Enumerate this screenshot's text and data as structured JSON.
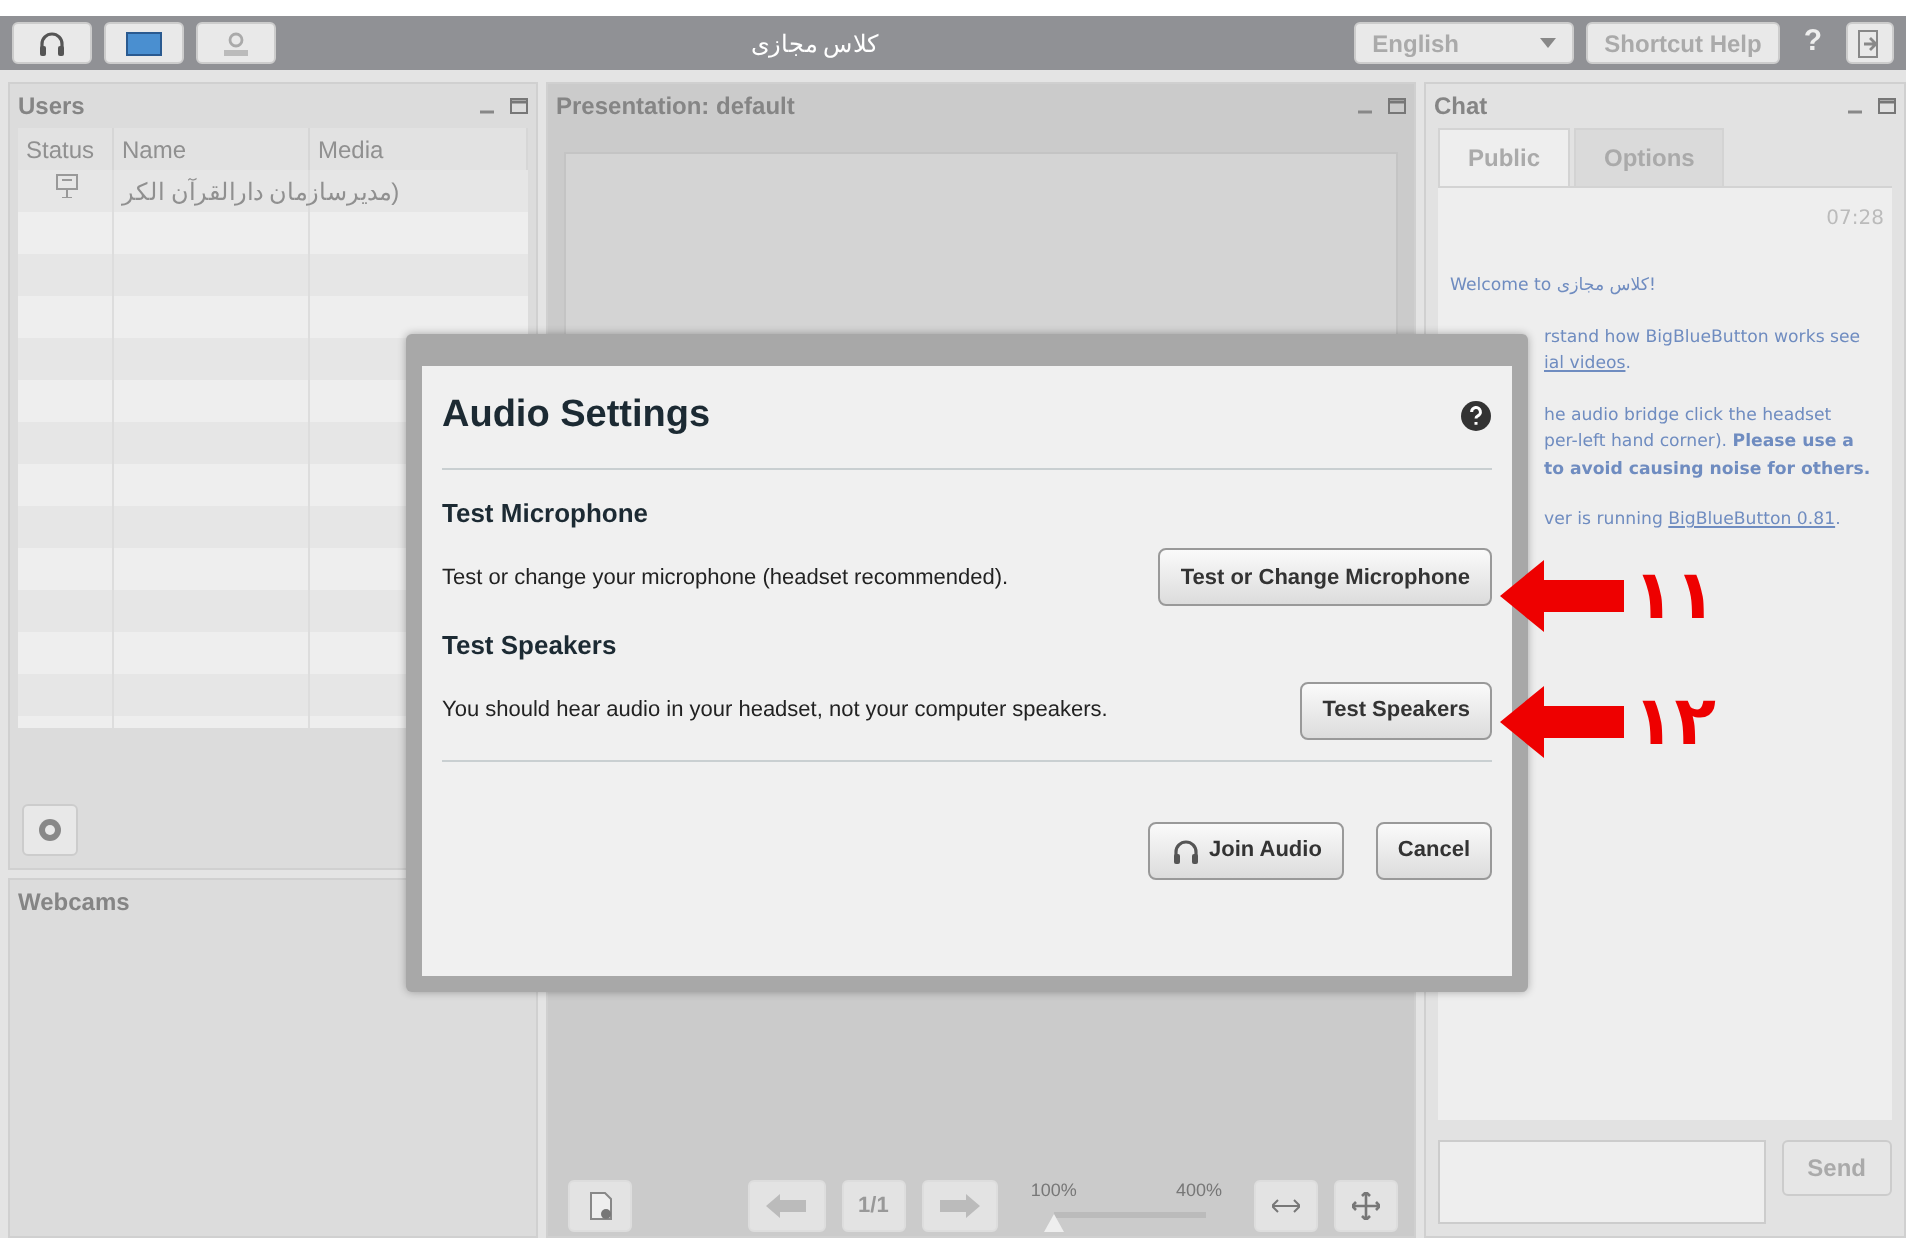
{
  "top_bar": {
    "title": "کلاس مجازی",
    "language": "English",
    "shortcut_help": "Shortcut Help",
    "help": "?"
  },
  "users_panel": {
    "title": "Users",
    "columns": [
      "Status",
      "Name",
      "Media"
    ],
    "rows": [
      {
        "name": "(مدیرسازمان دارالقرآن الکر"
      }
    ]
  },
  "webcams_panel": {
    "title": "Webcams"
  },
  "presentation_panel": {
    "title": "Presentation: default",
    "page": "1/1",
    "zoom_min": "100%",
    "zoom_max": "400%",
    "zoom": {
      "level": 0
    }
  },
  "chat_panel": {
    "title": "Chat",
    "tabs": [
      {
        "label": "Public",
        "selected": true
      },
      {
        "label": "Options",
        "selected": false
      }
    ],
    "time": "07:28",
    "paragraphs": [
      {
        "lines": [
          [
            {
              "kind": "text",
              "text": "Welcome to کلاس مجازی!"
            }
          ]
        ]
      },
      {
        "lines": [
          [
            {
              "kind": "text",
              "text": "rstand how BigBlueButton works see"
            }
          ],
          [
            {
              "kind": "link",
              "text": "ial videos"
            },
            {
              "kind": "text",
              "text": "."
            }
          ]
        ]
      },
      {
        "lines": [
          [
            {
              "kind": "text",
              "text": "he audio bridge click the headset"
            }
          ],
          [
            {
              "kind": "text",
              "text": "per-left hand corner). **Please use a**"
            }
          ],
          [
            {
              "kind": "bold",
              "text": "to avoid causing noise for others."
            }
          ]
        ]
      },
      {
        "lines": [
          [
            {
              "kind": "text",
              "text": "ver is running "
            },
            {
              "kind": "link",
              "text": "BigBlueButton 0.81"
            },
            {
              "kind": "text",
              "text": "."
            }
          ]
        ]
      }
    ],
    "send": "Send"
  },
  "dialog": {
    "title": "Audio Settings",
    "sections": [
      {
        "heading": "Test Microphone",
        "text": "Test or change your microphone (headset recommended).",
        "button": "Test or Change Microphone"
      },
      {
        "heading": "Test Speakers",
        "text": "You should hear audio in your headset, not your computer speakers.",
        "button": "Test Speakers"
      }
    ],
    "join": "Join Audio",
    "cancel": "Cancel"
  },
  "annotations": [
    {
      "label": "۱۱"
    },
    {
      "label": "۱۲"
    }
  ]
}
